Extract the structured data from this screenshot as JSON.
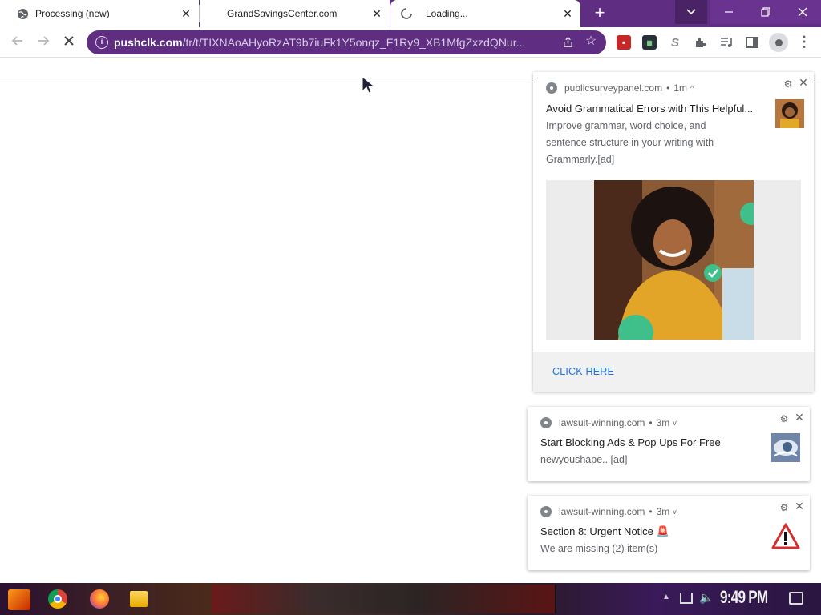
{
  "tabs": [
    {
      "title": "Processing (new)",
      "icon": "globe-icon",
      "close": "✕"
    },
    {
      "title": "GrandSavingsCenter.com",
      "icon": "none",
      "close": "✕"
    },
    {
      "title": "Loading...",
      "icon": "loading-spinner-icon",
      "close": "✕"
    }
  ],
  "window_controls": {
    "new_tab": "+",
    "tab_search": "⌄",
    "minimize": "—",
    "maximize": "❐",
    "close": "✕"
  },
  "toolbar": {
    "url_domain": "pushclk.com",
    "url_path": "/tr/t/TIXNAoAHyoRzAT9b7iuFk1Y5onqz_F1Ry9_XB1MfgZxzdQNur...",
    "extensions": [
      "red-extension-icon",
      "dark-extension-icon",
      "s-extension-icon",
      "puzzle-icon",
      "media-control-icon",
      "side-panel-icon"
    ],
    "ext_labels": {
      "s": "S",
      "dark": "▦"
    }
  },
  "notifications": [
    {
      "source": "publicsurveypanel.com",
      "age": "1m",
      "caret": "^",
      "title": "Avoid Grammatical Errors with This Helpful...",
      "body_lines": [
        "Improve grammar, word choice, and",
        "sentence structure in your writing with",
        "Grammarly.[ad]"
      ],
      "action": "CLICK HERE"
    },
    {
      "source": "lawsuit-winning.com",
      "age": "3m",
      "caret": "v",
      "title": "Start Blocking Ads & Pop Ups For Free",
      "body": "newyoushape.. [ad]"
    },
    {
      "source": "lawsuit-winning.com",
      "age": "3m",
      "caret": "v",
      "title": "Section 8: Urgent Notice 🚨",
      "body": "We are missing (2) item(s)"
    }
  ],
  "taskbar": {
    "clock": "9:49 PM"
  },
  "colors": {
    "brand": "#5f2d82",
    "link": "#1a73e8"
  }
}
